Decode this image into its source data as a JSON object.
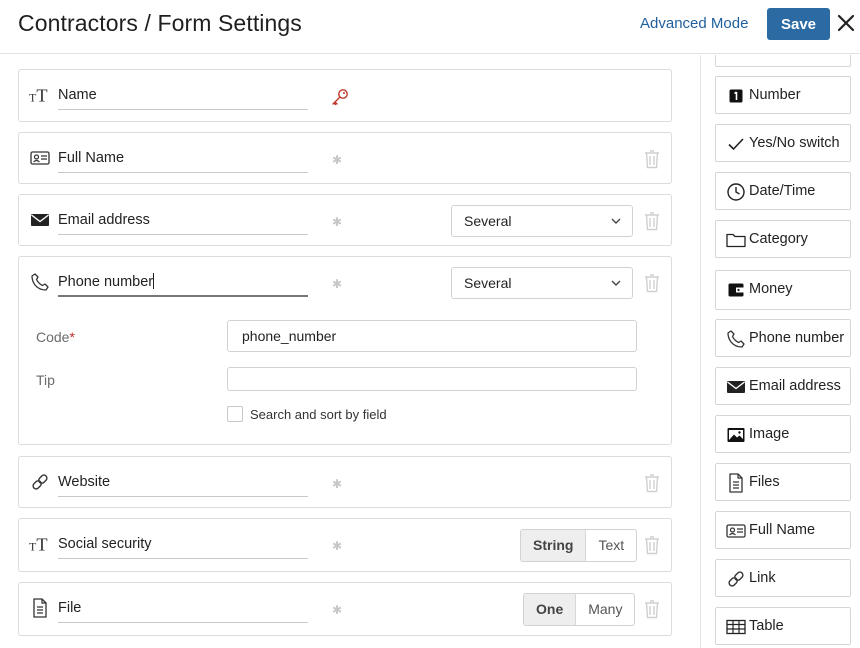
{
  "header": {
    "title": "Contractors / Form Settings",
    "advanced_mode": "Advanced Mode",
    "save": "Save"
  },
  "fields": [
    {
      "name": "Name",
      "icon": "text-icon",
      "marker": "key-icon"
    },
    {
      "name": "Full Name",
      "icon": "id-card-icon"
    },
    {
      "name": "Email address",
      "icon": "envelope-icon",
      "mode": "Several"
    },
    {
      "name": "Phone number",
      "icon": "phone-icon",
      "mode": "Several",
      "code_label": "Code",
      "code_required_mark": "*",
      "code_value": "phone_number",
      "tip_label": "Tip",
      "tip_value": "",
      "search_label": "Search and sort by field"
    },
    {
      "name": "Website",
      "icon": "link-icon"
    },
    {
      "name": "Social security",
      "icon": "text-icon",
      "options": [
        "String",
        "Text"
      ],
      "selected": "String"
    },
    {
      "name": "File",
      "icon": "file-icon",
      "options": [
        "One",
        "Many"
      ],
      "selected": "One"
    }
  ],
  "palette": [
    {
      "label": "Number",
      "icon": "number-icon"
    },
    {
      "label": "Yes/No switch",
      "icon": "check-icon"
    },
    {
      "label": "Date/Time",
      "icon": "clock-icon"
    },
    {
      "label": "Category",
      "icon": "folder-icon"
    },
    {
      "label": "Money",
      "icon": "wallet-icon"
    },
    {
      "label": "Phone number",
      "icon": "phone-icon"
    },
    {
      "label": "Email address",
      "icon": "envelope-icon"
    },
    {
      "label": "Image",
      "icon": "image-icon"
    },
    {
      "label": "Files",
      "icon": "file-icon"
    },
    {
      "label": "Full Name",
      "icon": "id-card-icon"
    },
    {
      "label": "Link",
      "icon": "link-icon"
    },
    {
      "label": "Table",
      "icon": "table-icon"
    }
  ],
  "colors": {
    "primary": "#2b6aa3",
    "link": "#1f5f9e",
    "key_accent": "#c0392b",
    "required": "#c02a2a",
    "border": "#dcdcdc"
  }
}
